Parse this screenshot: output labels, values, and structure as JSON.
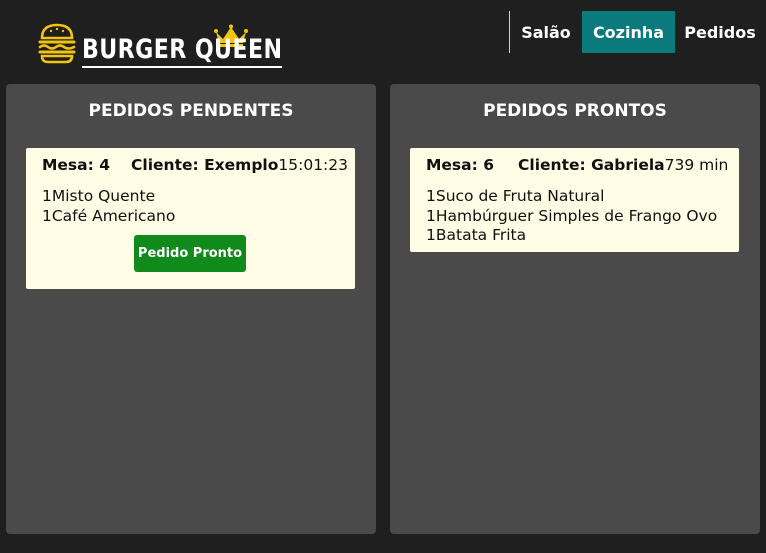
{
  "header": {
    "logo_text": "BURGER QUEEN",
    "nav": {
      "salao": "Salão",
      "cozinha": "Cozinha",
      "pedidos": "Pedidos"
    },
    "active_tab": "Cozinha",
    "accent_color": "#0a7a7c"
  },
  "pending": {
    "title": "PEDIDOS PENDENTES",
    "orders": [
      {
        "mesa": "Mesa: 4",
        "cliente": "Cliente: Exemplo",
        "time": "15:01:23",
        "items": [
          "1Misto Quente",
          "1Café Americano"
        ],
        "button": "Pedido Pronto"
      }
    ]
  },
  "ready": {
    "title": "PEDIDOS PRONTOS",
    "orders": [
      {
        "mesa": "Mesa: 6",
        "cliente": "Cliente: Gabriela",
        "time": "739 min",
        "items": [
          "1Suco de Fruta Natural",
          "1Hambúrguer Simples de Frango Ovo",
          "1Batata Frita"
        ]
      }
    ]
  },
  "icons": {
    "logo": "burger-icon",
    "crown": "crown-icon"
  },
  "colors": {
    "background": "#1f1f1f",
    "panel": "#4a4a4a",
    "card": "#fffde6",
    "button": "#118a1c"
  }
}
